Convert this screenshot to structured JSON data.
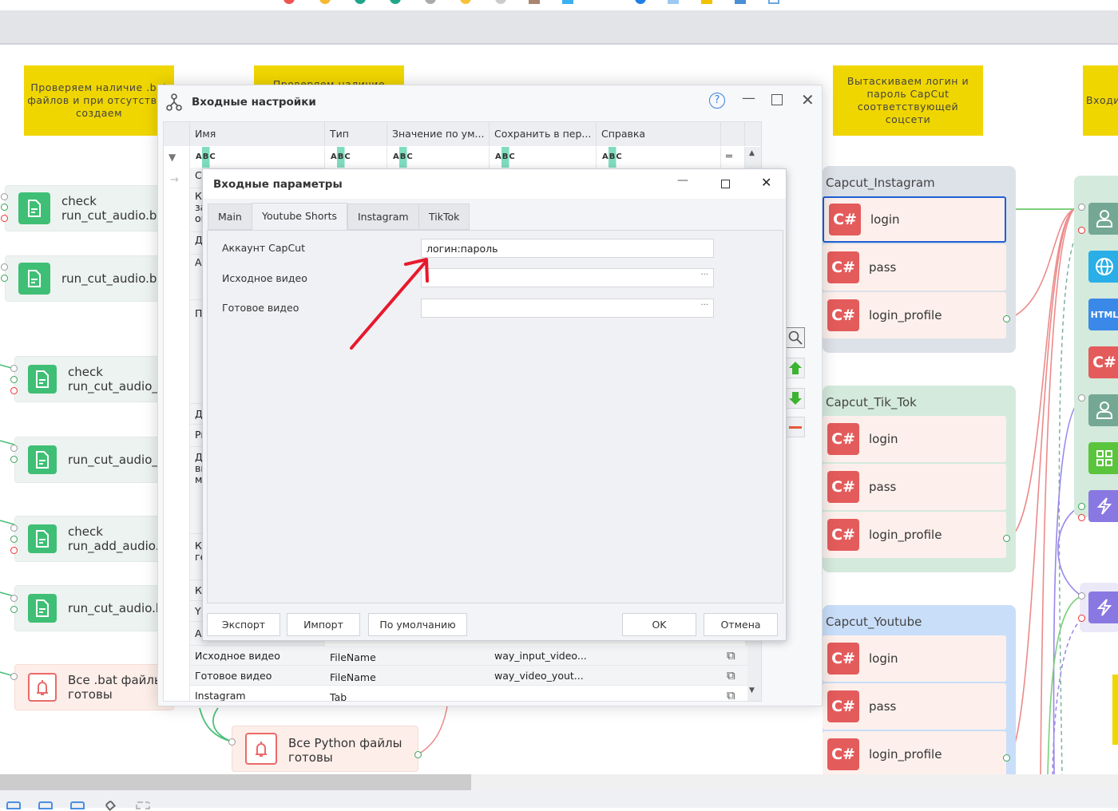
{
  "notes": [
    "Проверяем наличие .bat файлов и при отсутствии создаем",
    "Проверяем наличие",
    "Вытаскиваем логин и пароль CapCut соответствующей соцсети",
    "Входи"
  ],
  "left_nodes": [
    {
      "line1": "check",
      "line2": "run_cut_audio.bat"
    },
    {
      "line1": "run_cut_audio.bat",
      "line2": ""
    },
    {
      "line1": "check",
      "line2": "run_cut_audio_fil"
    },
    {
      "line1": "run_cut_audio_fil",
      "line2": ""
    },
    {
      "line1": "check",
      "line2": "run_add_audio.ba"
    },
    {
      "line1": "run_cut_audio.ba",
      "line2": ""
    },
    {
      "line1": "Все .bat файлы",
      "line2": "готовы"
    },
    {
      "line1": "Все Python файлы",
      "line2": "готовы"
    }
  ],
  "groups": [
    {
      "title": "Capcut_Instagram",
      "items": [
        "login",
        "pass",
        "login_profile"
      ]
    },
    {
      "title": "Capcut_Tik_Tok",
      "items": [
        "login",
        "pass",
        "login_profile"
      ]
    },
    {
      "title": "Capcut_Youtube",
      "items": [
        "login",
        "pass",
        "login_profile"
      ]
    }
  ],
  "csharp_label": "C#",
  "html_label": "HTML",
  "outer_dialog": {
    "title": "Входные настройки",
    "columns": [
      "Имя",
      "Тип",
      "Значение по ум...",
      "Сохранить в пер...",
      "Справка"
    ],
    "filter_token": "ABC",
    "left_fragments": [
      "С",
      "К\nза\nок",
      "Д",
      "А",
      "П",
      "Д",
      "Pr",
      "Д\nви\nм",
      "К\nге",
      "К",
      "Y",
      "А"
    ],
    "rows": [
      {
        "name": "Исходное видео",
        "type": "FileName",
        "default": "",
        "save": "way_input_video...",
        "help": ""
      },
      {
        "name": "Готовое видео",
        "type": "FileName",
        "default": "",
        "save": "way_video_yout...",
        "help": ""
      },
      {
        "name": "Instagram",
        "type": "Tab",
        "default": "",
        "save": "",
        "help": ""
      }
    ]
  },
  "inner_dialog": {
    "title": "Входные параметры",
    "tabs": [
      "Main",
      "Youtube Shorts",
      "Instagram",
      "TikTok"
    ],
    "active_tab": "Youtube Shorts",
    "fields": [
      {
        "label": "Аккаунт CapCut",
        "value": "логин:пароль"
      },
      {
        "label": "Исходное видео",
        "value": "",
        "browse": "···"
      },
      {
        "label": "Готовое видео",
        "value": "",
        "browse": "···"
      }
    ],
    "buttons": {
      "export": "Экспорт",
      "import": "Импорт",
      "default": "По умолчанию",
      "ok": "OK",
      "cancel": "Отмена"
    }
  },
  "annotation_color": "#e8182c"
}
